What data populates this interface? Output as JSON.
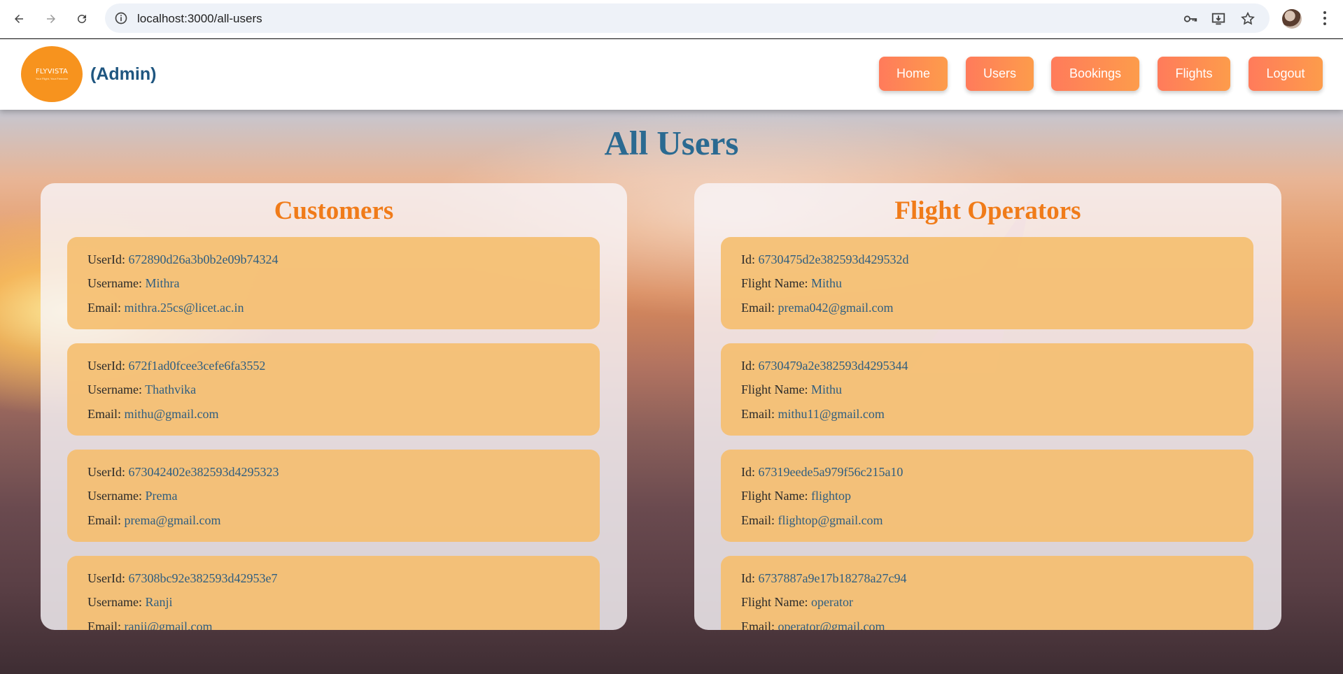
{
  "browser": {
    "url": "localhost:3000/all-users"
  },
  "header": {
    "logo_title": "FLYVISTA",
    "logo_tagline": "Your Flight, Your Freedom",
    "role_label": "(Admin)",
    "nav": [
      "Home",
      "Users",
      "Bookings",
      "Flights",
      "Logout"
    ]
  },
  "page_title": "All Users",
  "customers": {
    "title": "Customers",
    "labels": {
      "id": "UserId:",
      "name": "Username:",
      "email": "Email:"
    },
    "items": [
      {
        "id": "672890d26a3b0b2e09b74324",
        "name": "Mithra",
        "email": "mithra.25cs@licet.ac.in"
      },
      {
        "id": "672f1ad0fcee3cefe6fa3552",
        "name": "Thathvika",
        "email": "mithu@gmail.com"
      },
      {
        "id": "673042402e382593d4295323",
        "name": "Prema",
        "email": "prema@gmail.com"
      },
      {
        "id": "67308bc92e382593d42953e7",
        "name": "Ranji",
        "email": "ranji@gmail.com"
      }
    ]
  },
  "operators": {
    "title": "Flight Operators",
    "labels": {
      "id": "Id:",
      "name": "Flight Name:",
      "email": "Email:"
    },
    "items": [
      {
        "id": "6730475d2e382593d429532d",
        "name": "Mithu",
        "email": "prema042@gmail.com"
      },
      {
        "id": "6730479a2e382593d4295344",
        "name": "Mithu",
        "email": "mithu11@gmail.com"
      },
      {
        "id": "67319eede5a979f56c215a10",
        "name": "flightop",
        "email": "flightop@gmail.com"
      },
      {
        "id": "6737887a9e17b18278a27c94",
        "name": "operator",
        "email": "operator@gmail.com"
      }
    ]
  },
  "colors": {
    "accent": "#f07b19",
    "title_blue": "#2b6a91",
    "button_gradient_start": "#ff7b5b",
    "button_gradient_end": "#fd9c4b",
    "card_bg": "#f5be6e"
  }
}
